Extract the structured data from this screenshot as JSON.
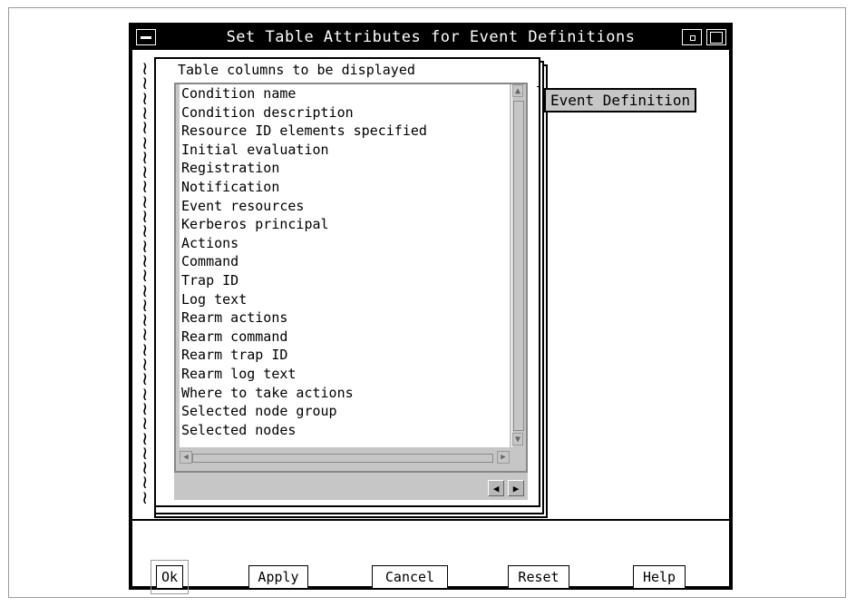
{
  "window": {
    "title": "Set Table Attributes for Event Definitions"
  },
  "notebook": {
    "label": "Table columns to be displayed",
    "items": [
      "Condition name",
      "Condition description",
      "Resource ID elements specified",
      "Initial evaluation",
      "Registration",
      "Notification",
      "Event resources",
      "Kerberos principal",
      "Actions",
      "Command",
      "Trap ID",
      "Log text",
      "Rearm actions",
      "Rearm command",
      "Rearm trap ID",
      "Rearm log text",
      "Where to take actions",
      "Selected node group",
      "Selected nodes"
    ],
    "tab_label": "Event Definition"
  },
  "buttons": {
    "ok": "Ok",
    "apply": "Apply",
    "cancel": "Cancel",
    "reset": "Reset",
    "help": "Help"
  },
  "icons": {
    "window_menu": "window-menu-icon",
    "minimize": "minimize-icon",
    "maximize": "maximize-icon",
    "spiral": "spiral-binding-icon"
  }
}
